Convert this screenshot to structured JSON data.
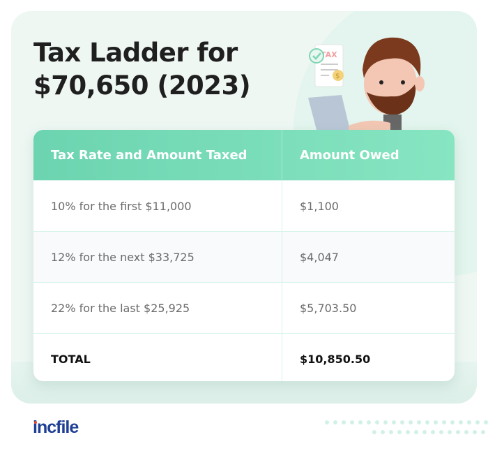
{
  "title_lines": [
    "Tax Ladder for",
    "$70,650 (2023)"
  ],
  "illustration": {
    "doc_label": "TAX",
    "icons": [
      "check-icon",
      "dollar-coin-icon",
      "laptop-icon",
      "bearded-man-character"
    ]
  },
  "table": {
    "headers": [
      "Tax Rate and Amount Taxed",
      "Amount Owed"
    ],
    "rows": [
      {
        "rate": "10% for the first $11,000",
        "owed": "$1,100"
      },
      {
        "rate": "12% for the next $33,725",
        "owed": "$4,047"
      },
      {
        "rate": "22% for the last $25,925",
        "owed": "$5,703.50"
      }
    ],
    "total": {
      "label": "TOTAL",
      "owed": "$10,850.50"
    }
  },
  "brand": {
    "name": "incfile"
  },
  "colors": {
    "header_start": "#6cd4b0",
    "header_end": "#87e5c2",
    "background": "#eff7f3",
    "brand": "#1f3f95",
    "brand_dot": "#e84a2d"
  }
}
